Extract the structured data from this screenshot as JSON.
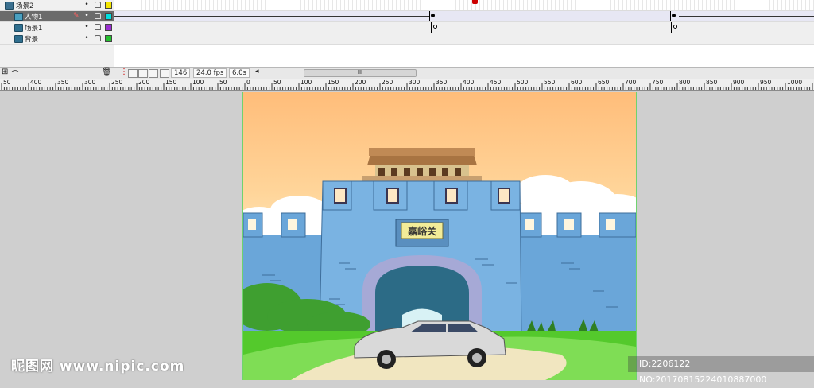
{
  "layers": [
    {
      "name": "场景2",
      "selected": false,
      "color": "#f3e600"
    },
    {
      "name": "人物1",
      "selected": true,
      "color": "#00e0e0"
    },
    {
      "name": "场景1",
      "selected": false,
      "color": "#9a2fd0"
    },
    {
      "name": "背景",
      "selected": false,
      "color": "#24c12e"
    }
  ],
  "layer_controls": {
    "visible_dot": "•"
  },
  "timeline_footer": {
    "current_frame": "146",
    "frame_rate": "24.0 fps",
    "elapsed_time": "6.0s",
    "scroll_left": "◂",
    "scroll_grip": "III"
  },
  "ruler": {
    "labels": [
      "50",
      "400",
      "350",
      "300",
      "250",
      "200",
      "150",
      "100",
      "50",
      "0",
      "50",
      "100",
      "150",
      "200",
      "250",
      "300",
      "350",
      "400",
      "450",
      "500",
      "550",
      "600",
      "650",
      "700",
      "750",
      "800",
      "850",
      "900",
      "950",
      "1000"
    ]
  },
  "stage": {
    "gate_sign": "嘉峪关",
    "accent_sky_top": "#ffbd7a",
    "wall_color": "#6aa6d9",
    "grass_color": "#54c92c"
  },
  "watermarks": {
    "left": "昵图网 www.nipic.com",
    "right": "ID:2206122 NO:20170815224010887000"
  },
  "icons": {
    "eye": "eye-icon",
    "lock": "lock-icon",
    "trash": "trash-icon"
  }
}
